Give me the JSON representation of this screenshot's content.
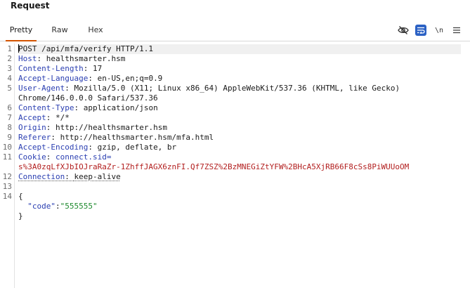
{
  "panel": {
    "title": "Request"
  },
  "tabs": [
    {
      "label": "Pretty",
      "active": true
    },
    {
      "label": "Raw",
      "active": false
    },
    {
      "label": "Hex",
      "active": false
    }
  ],
  "toolbar": {
    "icons": [
      "eye-slash-icon",
      "word-wrap-icon",
      "newline-toggle-icon",
      "menu-icon"
    ],
    "newline_label": "\\n",
    "accent_color": "#2b61c4"
  },
  "editor": {
    "line_numbers": [
      "1",
      "2",
      "3",
      "4",
      "5",
      "",
      "6",
      "7",
      "8",
      "9",
      "10",
      "11",
      "",
      "12",
      "13",
      "14"
    ],
    "request_line": "POST /api/mfa/verify HTTP/1.1",
    "headers": [
      {
        "name": "Host",
        "value": "healthsmarter.hsm"
      },
      {
        "name": "Content-Length",
        "value": "17"
      },
      {
        "name": "Accept-Language",
        "value": "en-US,en;q=0.9"
      },
      {
        "name": "User-Agent",
        "value": "Mozilla/5.0 (X11; Linux x86_64) AppleWebKit/537.36 (KHTML, like Gecko)",
        "value_cont": "Chrome/146.0.0.0 Safari/537.36"
      },
      {
        "name": "Content-Type",
        "value": "application/json"
      },
      {
        "name": "Accept",
        "value": "*/*"
      },
      {
        "name": "Origin",
        "value": "http://healthsmarter.hsm"
      },
      {
        "name": "Referer",
        "value": "http://healthsmarter.hsm/mfa.html"
      },
      {
        "name": "Accept-Encoding",
        "value": "gzip, deflate, br"
      }
    ],
    "cookie": {
      "name": "Cookie",
      "cookie_name": "connect.sid",
      "value": "s%3A0zqLfXJbIOJraRaZr-1ZhffJAGX6znFI.Qf7ZSZ%2BzMNEGiZtYFW%2BHcA5XjRB66F8cSs8PiWUUoOM"
    },
    "connection": {
      "name": "Connection",
      "value": "keep-alive"
    },
    "body": {
      "open": "{",
      "key": "\"code\"",
      "value": "\"555555\"",
      "close": "}"
    }
  }
}
